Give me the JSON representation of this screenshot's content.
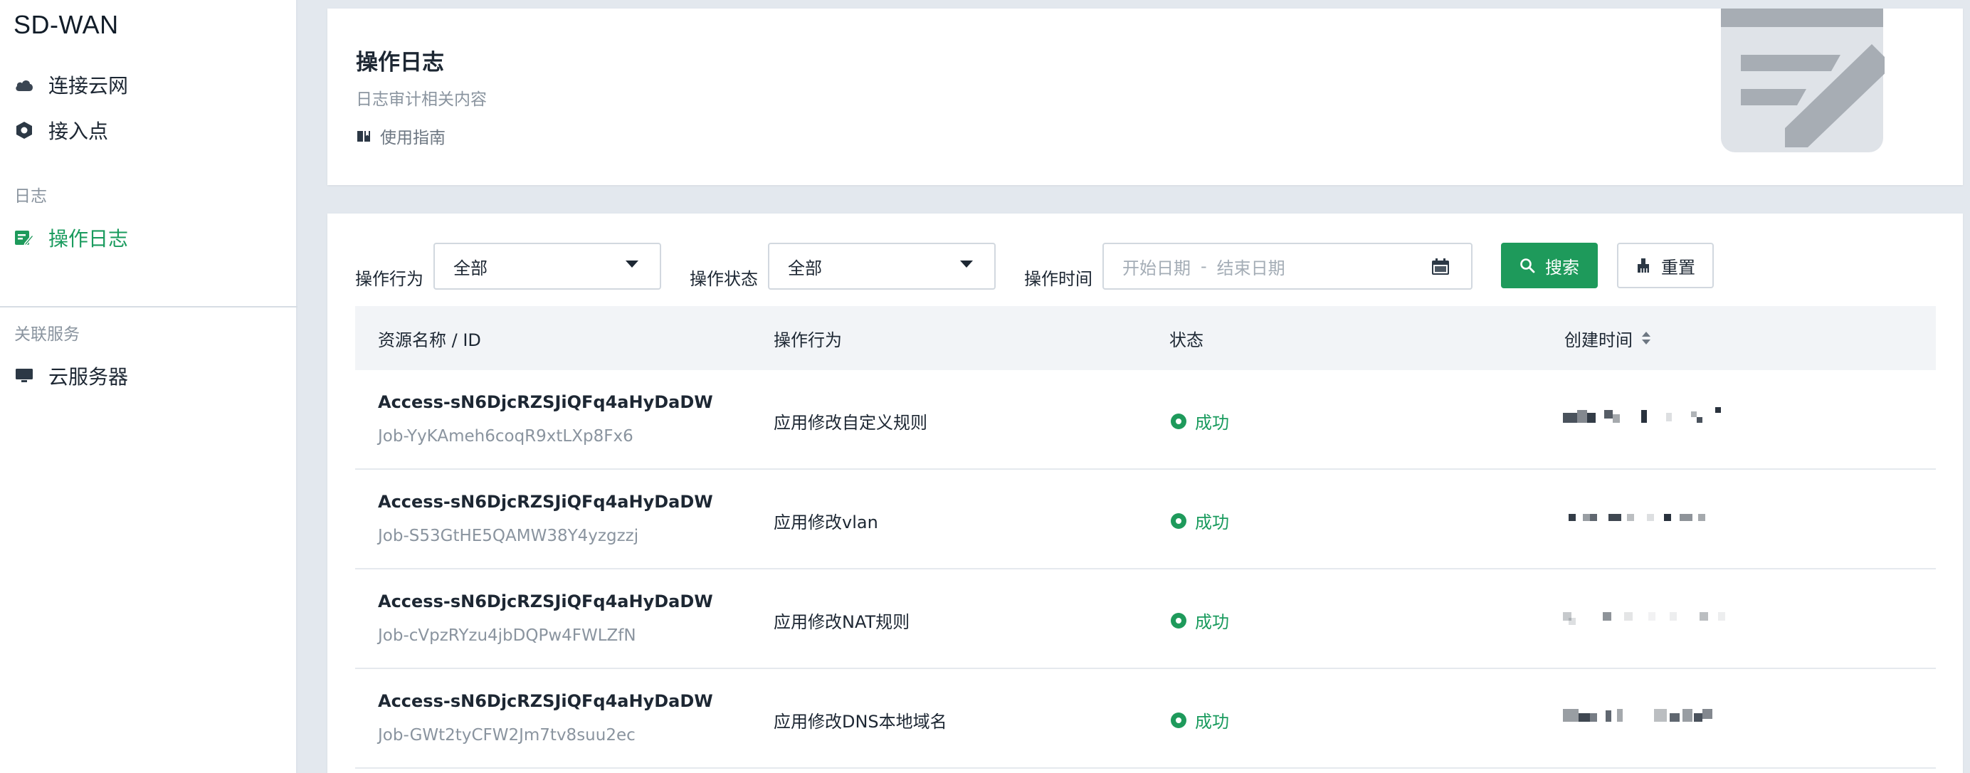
{
  "app": {
    "brand": "SD-WAN"
  },
  "sidebar": {
    "items_top": [
      {
        "label": "连接云网",
        "icon": "cloud-icon"
      },
      {
        "label": "接入点",
        "icon": "hexagon-node-icon"
      }
    ],
    "section_log": "日志",
    "items_log": [
      {
        "label": "操作日志",
        "icon": "edit-log-icon",
        "active": true
      }
    ],
    "section_related": "关联服务",
    "items_related": [
      {
        "label": "云服务器",
        "icon": "monitor-icon"
      }
    ]
  },
  "header": {
    "title": "操作日志",
    "subtitle": "日志审计相关内容",
    "guide": "使用指南"
  },
  "filters": {
    "action_label": "操作行为",
    "action_value": "全部",
    "status_label": "操作状态",
    "status_value": "全部",
    "time_label": "操作时间",
    "start_placeholder": "开始日期",
    "separator": "-",
    "end_placeholder": "结束日期",
    "search_button": "搜索",
    "reset_button": "重置"
  },
  "table": {
    "columns": {
      "name": "资源名称 / ID",
      "action": "操作行为",
      "status": "状态",
      "created": "创建时间"
    },
    "rows": [
      {
        "name": "Access-sN6DjcRZSJiQFq4aHyDaDW",
        "id": "Job-YyKAmeh6coqR9xtLXp8Fx6",
        "action": "应用修改自定义规则",
        "status": "成功"
      },
      {
        "name": "Access-sN6DjcRZSJiQFq4aHyDaDW",
        "id": "Job-S53GtHE5QAMW38Y4yzgzzj",
        "action": "应用修改vlan",
        "status": "成功"
      },
      {
        "name": "Access-sN6DjcRZSJiQFq4aHyDaDW",
        "id": "Job-cVpzRYzu4jbDQPw4FWLZfN",
        "action": "应用修改NAT规则",
        "status": "成功"
      },
      {
        "name": "Access-sN6DjcRZSJiQFq4aHyDaDW",
        "id": "Job-GWt2tyCFW2Jm7tv8suu2ec",
        "action": "应用修改DNS本地域名",
        "status": "成功"
      }
    ]
  },
  "colors": {
    "accent": "#1e9a5b",
    "background": "#e3e8ee",
    "text": "#1d2733",
    "muted": "#8a949f"
  }
}
